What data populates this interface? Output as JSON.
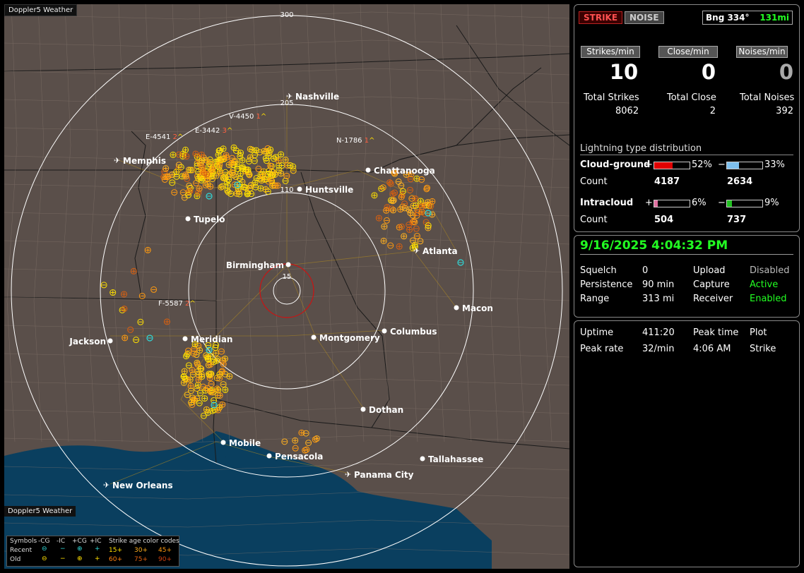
{
  "map": {
    "brand": "Doppler5 Weather",
    "range_labels": [
      "300",
      "205",
      "110",
      "15"
    ],
    "cities": [
      {
        "name": "Nashville",
        "icon": "airport-icon"
      },
      {
        "name": "Memphis",
        "icon": "airport-icon"
      },
      {
        "name": "Chattanooga",
        "icon": "city-dot"
      },
      {
        "name": "Huntsville",
        "icon": "city-dot"
      },
      {
        "name": "Tupelo",
        "icon": "city-dot"
      },
      {
        "name": "Atlanta",
        "icon": "airport-icon"
      },
      {
        "name": "Birmingham",
        "icon": "city-dot"
      },
      {
        "name": "Macon",
        "icon": "city-dot"
      },
      {
        "name": "Jackson",
        "icon": "city-dot"
      },
      {
        "name": "Meridian",
        "icon": "city-dot"
      },
      {
        "name": "Montgomery",
        "icon": "city-dot"
      },
      {
        "name": "Columbus",
        "icon": "city-dot"
      },
      {
        "name": "Dothan",
        "icon": "city-dot"
      },
      {
        "name": "Mobile",
        "icon": "city-dot"
      },
      {
        "name": "Pensacola",
        "icon": "city-dot"
      },
      {
        "name": "Tallahassee",
        "icon": "city-dot"
      },
      {
        "name": "Panama City",
        "icon": "airport-icon"
      },
      {
        "name": "New Orleans",
        "icon": "airport-icon"
      }
    ],
    "cells": [
      {
        "id": "V-4450",
        "count": "1"
      },
      {
        "id": "E-4541",
        "count": "2"
      },
      {
        "id": "E-3442",
        "count": "3"
      },
      {
        "id": "N-1786",
        "count": "1"
      },
      {
        "id": "F-5587",
        "count": "2"
      }
    ],
    "legend": {
      "symbols_label": "Symbols",
      "recent_label": "Recent",
      "old_label": "Old",
      "columns": [
        "-CG",
        "-IC",
        "+CG",
        "+IC"
      ],
      "age_title": "Strike age color codes",
      "recent_ages": [
        "15+",
        "30+",
        "45+"
      ],
      "old_ages": [
        "60+",
        "75+",
        "90+"
      ]
    }
  },
  "panel": {
    "strike_label": "STRIKE",
    "noise_label": "NOISE",
    "bearing": "Bng 334°",
    "distance": "131mi",
    "rates": [
      {
        "header": "Strikes/min",
        "value": "10",
        "total_label": "Total Strikes",
        "total": "8062"
      },
      {
        "header": "Close/min",
        "value": "0",
        "total_label": "Total Close",
        "total": "2"
      },
      {
        "header": "Noises/min",
        "value": "0",
        "total_label": "Total Noises",
        "total": "392"
      }
    ],
    "distribution": {
      "title": "Lightning type distribution",
      "cloud_ground": {
        "label": "Cloud-ground",
        "pos_pct": "52%",
        "neg_pct": "33%",
        "pos_count": "4187",
        "neg_count": "2634",
        "pos_frac": 0.52,
        "neg_frac": 0.33
      },
      "intracloud": {
        "label": "Intracloud",
        "pos_pct": "6%",
        "neg_pct": "9%",
        "pos_count": "504",
        "neg_count": "737",
        "pos_frac": 0.06,
        "neg_frac": 0.09
      },
      "count_label": "Count",
      "plus": "+",
      "minus": "−"
    },
    "datetime": "9/16/2025 4:04:32 PM",
    "status": {
      "squelch_label": "Squelch",
      "squelch": "0",
      "persistence_label": "Persistence",
      "persistence": "90 min",
      "range_label": "Range",
      "range": "313 mi",
      "upload_label": "Upload",
      "upload": "Disabled",
      "capture_label": "Capture",
      "capture": "Active",
      "receiver_label": "Receiver",
      "receiver": "Enabled"
    },
    "stats": {
      "uptime_label": "Uptime",
      "uptime": "411:20",
      "peak_rate_label": "Peak rate",
      "peak_rate": "32/min",
      "peak_time_label": "Peak time",
      "peak_time": "4:06 AM",
      "plot_label": "Plot",
      "plot": "Strike"
    }
  },
  "colors": {
    "map_bg": "#5a4f4a",
    "water": "#0a3f5f",
    "ring": "#ffffff",
    "close_ring": "#d01010",
    "strike_yellow": "#ffe000",
    "strike_orange": "#ff9a10",
    "strike_dark_orange": "#d86010",
    "strike_cyan": "#30d8d8",
    "positive_bar": "#e00000",
    "negative_bar": "#7ec0ee",
    "ic_positive_bar": "#e070a0",
    "ic_negative_bar": "#20c020",
    "active_green": "#22ff22"
  }
}
